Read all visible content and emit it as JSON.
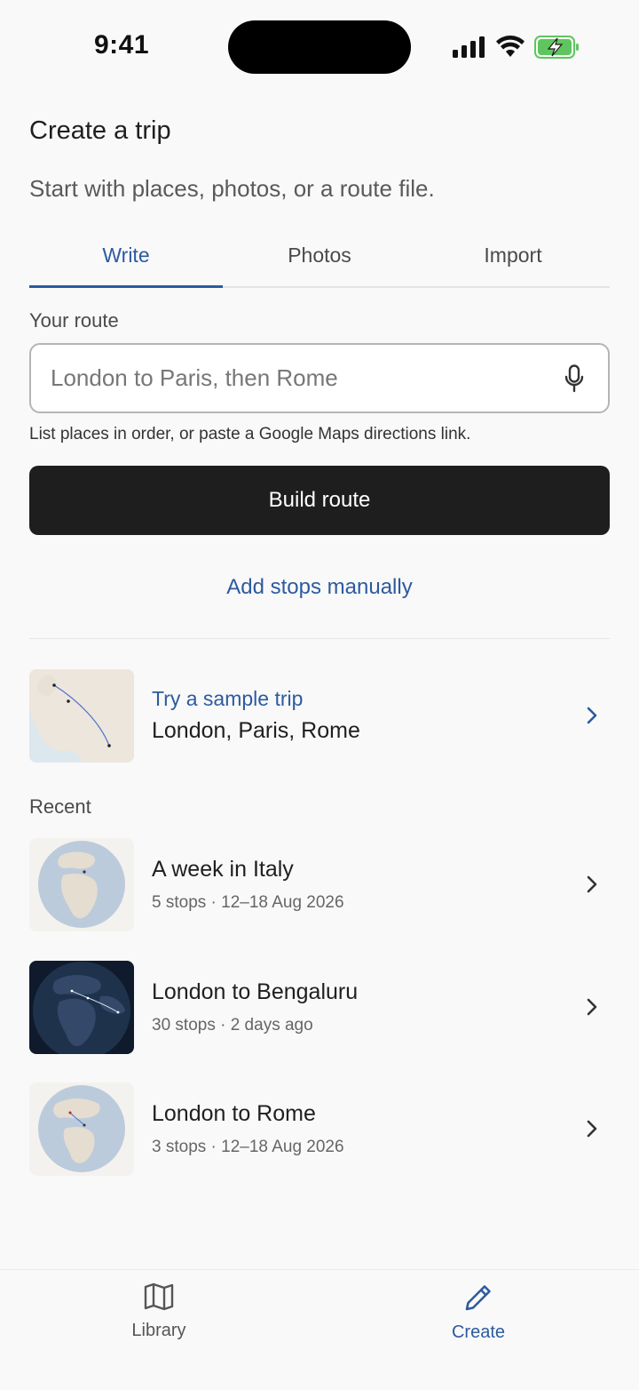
{
  "status_bar": {
    "time": "9:41"
  },
  "header": {
    "title": "Create a trip",
    "subtitle": "Start with places, photos, or a route file."
  },
  "tabs": [
    {
      "label": "Write",
      "active": true
    },
    {
      "label": "Photos",
      "active": false
    },
    {
      "label": "Import",
      "active": false
    }
  ],
  "route": {
    "label": "Your route",
    "placeholder": "London to Paris, then Rome",
    "value": "",
    "helper": "List places in order, or paste a Google Maps directions link."
  },
  "actions": {
    "build": "Build route",
    "manual": "Add stops manually"
  },
  "sample": {
    "kicker": "Try a sample trip",
    "title": "London, Paris, Rome"
  },
  "recent": {
    "label": "Recent",
    "items": [
      {
        "title": "A week in Italy",
        "meta": "5 stops · 12–18 Aug 2026",
        "thumb": "globe-light"
      },
      {
        "title": "London to Bengaluru",
        "meta": "30 stops · 2 days ago",
        "thumb": "globe-dark"
      },
      {
        "title": "London to Rome",
        "meta": "3 stops · 12–18 Aug 2026",
        "thumb": "globe-light"
      }
    ]
  },
  "nav": {
    "library": "Library",
    "create": "Create",
    "active": "create"
  },
  "colors": {
    "accent": "#2d5aa0",
    "primary_button": "#1e1e1e",
    "background": "#f9f9f9"
  }
}
